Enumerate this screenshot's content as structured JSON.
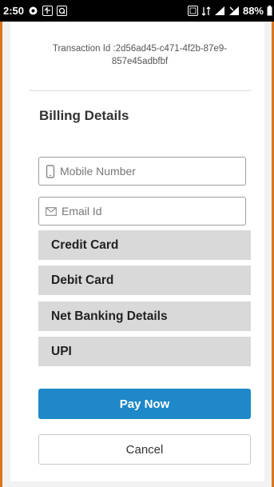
{
  "status_bar": {
    "time": "2:50",
    "battery": "88%",
    "icons": [
      "notification-icon",
      "app-icon",
      "app-icon-2",
      "network-icon",
      "data-icon",
      "wifi-icon",
      "signal-icon",
      "battery-icon"
    ]
  },
  "transaction": {
    "text": "Transaction Id :2d56ad45-c471-4f2b-87e9-857e45adbfbf"
  },
  "billing": {
    "title": "Billing Details",
    "mobile_placeholder": "Mobile Number",
    "email_placeholder": "Email Id"
  },
  "payment_options": [
    {
      "label": "Credit Card"
    },
    {
      "label": "Debit Card"
    },
    {
      "label": "Net Banking Details"
    },
    {
      "label": "UPI"
    }
  ],
  "actions": {
    "pay_label": "Pay Now",
    "cancel_label": "Cancel"
  },
  "colors": {
    "accent": "#1e88c8",
    "option_bg": "#d9d9d9",
    "frame_border": "#d9761e"
  }
}
